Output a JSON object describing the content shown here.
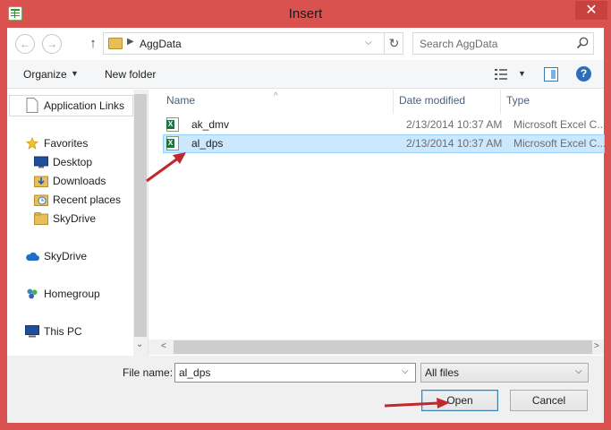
{
  "window": {
    "title": "Insert",
    "close_glyph": "✕"
  },
  "address_bar": {
    "back_glyph": "←",
    "forward_glyph": "→",
    "up_glyph": "↑",
    "breadcrumb_sep": "▶",
    "path": "AggData",
    "dropdown_glyph": "⌵",
    "refresh_glyph": "↻",
    "search_placeholder": "Search AggData"
  },
  "toolbar": {
    "organize_label": "Organize",
    "organize_arrow": "▼",
    "new_folder_label": "New folder",
    "views_arrow": "▼",
    "help_glyph": "?"
  },
  "nav_pane": {
    "items": [
      {
        "label": "Application Links",
        "icon": "page-icon"
      },
      {
        "label": "Favorites",
        "icon": "star-icon"
      },
      {
        "label": "Desktop",
        "icon": "desktop-icon"
      },
      {
        "label": "Downloads",
        "icon": "downloads-icon"
      },
      {
        "label": "Recent places",
        "icon": "recent-places-icon"
      },
      {
        "label": "SkyDrive",
        "icon": "folder-icon"
      },
      {
        "label": "SkyDrive",
        "icon": "cloud-icon"
      },
      {
        "label": "Homegroup",
        "icon": "homegroup-icon"
      },
      {
        "label": "This PC",
        "icon": "computer-icon"
      }
    ],
    "scroll_down_glyph": "⌄"
  },
  "file_list": {
    "sort_arrow": "^",
    "columns": {
      "name": "Name",
      "date": "Date modified",
      "type": "Type"
    },
    "rows": [
      {
        "name": "ak_dmv",
        "date": "2/13/2014 10:37 AM",
        "type": "Microsoft Excel C..."
      },
      {
        "name": "al_dps",
        "date": "2/13/2014 10:37 AM",
        "type": "Microsoft Excel C..."
      }
    ],
    "selected_index": 1,
    "scroll_left_glyph": "<",
    "scroll_right_glyph": ">"
  },
  "bottom": {
    "file_name_label": "File name:",
    "file_name_value": "al_dps",
    "file_name_drop": "⌵",
    "filter_value": "All files",
    "filter_drop": "⌵",
    "open_label": "Open",
    "cancel_label": "Cancel"
  },
  "colors": {
    "frame": "#d9524f",
    "selection_bg": "#cce8ff",
    "annotation_arrow": "#c0282d"
  }
}
